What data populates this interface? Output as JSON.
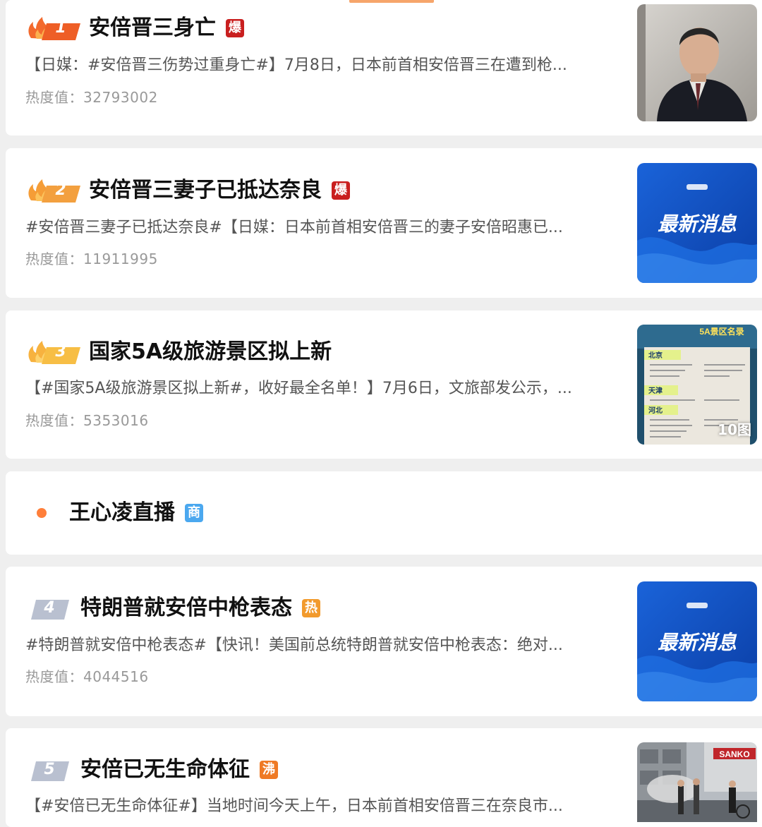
{
  "feed": {
    "items": [
      {
        "rank": "1",
        "title": "安倍晋三身亡",
        "badge": "爆",
        "summary": "【日媒：#安倍晋三伤势过重身亡#】7月8日，日本前首相安倍晋三在遭到枪...",
        "heat_label": "热度值：",
        "heat_value": "32793002",
        "thumbnail": "portrait-photo"
      },
      {
        "rank": "2",
        "title": "安倍晋三妻子已抵达奈良",
        "badge": "爆",
        "summary": "#安倍晋三妻子已抵达奈良#【日媒：日本前首相安倍晋三的妻子安倍昭惠已...",
        "heat_label": "热度值：",
        "heat_value": "11911995",
        "thumbnail_text": "最新消息"
      },
      {
        "rank": "3",
        "title": "国家5A级旅游景区拟上新",
        "summary": "【#国家5A级旅游景区拟上新#，收好最全名单！】7月6日，文旅部发公示，...",
        "heat_label": "热度值：",
        "heat_value": "5353016",
        "thumbnail_labels": [
          "5A景区名录",
          "北京",
          "天津",
          "河北"
        ],
        "thumbnail_count": "10图"
      },
      {
        "rank": "4",
        "title": "特朗普就安倍中枪表态",
        "badge": "热",
        "summary": "#特朗普就安倍中枪表态#【快讯！美国前总统特朗普就安倍中枪表态：绝对...",
        "heat_label": "热度值：",
        "heat_value": "4044516",
        "thumbnail_text": "最新消息"
      },
      {
        "rank": "5",
        "title": "安倍已无生命体征",
        "badge": "沸",
        "summary": "【#安倍已无生命体征#】当地时间今天上午，日本前首相安倍晋三在奈良市...",
        "thumbnail_text": "SANKO"
      }
    ],
    "live": {
      "title": "王心凌直播",
      "badge": "商"
    }
  },
  "colors": {
    "rank_fire_top1": "#f06a2b",
    "rank_fire_top2": "#f4a03a",
    "rank_fire_top3": "#f7bf3f",
    "rank_gray": "#b8bfcf",
    "accent_orange": "#f6a56b"
  }
}
